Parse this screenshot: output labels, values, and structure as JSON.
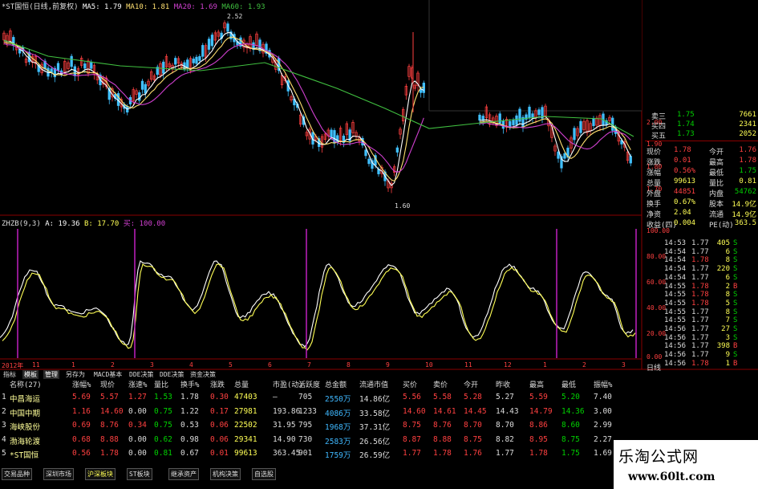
{
  "colors": {
    "up": "#ff4040",
    "down": "#00d000",
    "flat": "#e0e0e0",
    "border": "#8a0000",
    "cyan": "#3fb8ff",
    "yellow": "#ffff55",
    "ma5": "#ffffff",
    "ma10": "#ffe070",
    "ma20": "#d040d0",
    "ma60": "#40c040"
  },
  "header": {
    "title": "*ST国恒(日线,前复权)",
    "ma5": "MA5: 1.79",
    "ma10": "MA10: 1.81",
    "ma20": "MA20: 1.69",
    "ma60": "MA60: 1.93"
  },
  "price_annotations": {
    "high": "2.52",
    "low": "1.60"
  },
  "indicator": {
    "name": "ZHZB(9,3)",
    "a": "A: 19.36",
    "b": "B: 17.70",
    "buy": "买: 100.00"
  },
  "price_axis": [
    "2.00",
    "1.90",
    "1.80",
    "1.70"
  ],
  "indicator_axis": [
    "100.00",
    "80.00",
    "60.00",
    "40.00",
    "20.00",
    "0.00"
  ],
  "x_axis": {
    "year": "2012年",
    "days": [
      "11",
      "1",
      "2",
      "3",
      "4",
      "5",
      "6",
      "7",
      "8",
      "9",
      "10",
      "11",
      "12",
      "1",
      "2",
      "3"
    ]
  },
  "quote": {
    "rows": [
      {
        "label": "卖三",
        "price": "1.75",
        "vol": "7661"
      },
      {
        "label": "买四",
        "price": "1.74",
        "vol": "2341"
      },
      {
        "label": "买五",
        "price": "1.73",
        "vol": "2052"
      }
    ],
    "stats": [
      {
        "l1": "现价",
        "v1": "1.78",
        "l2": "今开",
        "v2": "1.76"
      },
      {
        "l1": "涨跌",
        "v1": "0.01",
        "l2": "最高",
        "v2": "1.78"
      },
      {
        "l1": "涨幅",
        "v1": "0.56%",
        "l2": "最低",
        "v2": "1.75"
      },
      {
        "l1": "总量",
        "v1": "99613",
        "l2": "量比",
        "v2": "0.81"
      },
      {
        "l1": "外盘",
        "v1": "44851",
        "l2": "内盘",
        "v2": "54762"
      },
      {
        "l1": "换手",
        "v1": "0.67%",
        "l2": "股本",
        "v2": "14.9亿"
      },
      {
        "l1": "净资",
        "v1": "2.04",
        "l2": "流通",
        "v2": "14.9亿"
      },
      {
        "l1": "收益(四)",
        "v1": "0.004",
        "l2": "PE(动)",
        "v2": "363.5"
      }
    ]
  },
  "ticks": [
    {
      "t": "14:53",
      "p": "1.77",
      "v": "405",
      "bs": "S",
      "c": "down"
    },
    {
      "t": "14:54",
      "p": "1.77",
      "v": "6",
      "bs": "S",
      "c": "down"
    },
    {
      "t": "14:54",
      "p": "1.78",
      "v": "8",
      "bs": "S",
      "c": "up"
    },
    {
      "t": "14:54",
      "p": "1.77",
      "v": "220",
      "bs": "S",
      "c": "down"
    },
    {
      "t": "14:54",
      "p": "1.77",
      "v": "6",
      "bs": "S",
      "c": "down"
    },
    {
      "t": "14:55",
      "p": "1.78",
      "v": "2",
      "bs": "B",
      "c": "up"
    },
    {
      "t": "14:55",
      "p": "1.78",
      "v": "8",
      "bs": "S",
      "c": "up"
    },
    {
      "t": "14:55",
      "p": "1.78",
      "v": "5",
      "bs": "S",
      "c": "up"
    },
    {
      "t": "14:55",
      "p": "1.77",
      "v": "8",
      "bs": "S",
      "c": "down"
    },
    {
      "t": "14:55",
      "p": "1.77",
      "v": "7",
      "bs": "S",
      "c": "down"
    },
    {
      "t": "14:56",
      "p": "1.77",
      "v": "27",
      "bs": "S",
      "c": "down"
    },
    {
      "t": "14:56",
      "p": "1.77",
      "v": "3",
      "bs": "S",
      "c": "down"
    },
    {
      "t": "14:56",
      "p": "1.77",
      "v": "398",
      "bs": "B",
      "c": "down"
    },
    {
      "t": "14:56",
      "p": "1.77",
      "v": "9",
      "bs": "S",
      "c": "down"
    },
    {
      "t": "14:56",
      "p": "1.78",
      "v": "1",
      "bs": "B",
      "c": "up"
    }
  ],
  "tabs": [
    "指标",
    "模板",
    "管理",
    "另存为",
    "MACD基本",
    "DDE决策",
    "DDE决策",
    "资金决策"
  ],
  "table": {
    "headers": [
      "名称(27)",
      "涨幅%",
      "现价",
      "涨速%",
      "量比",
      "换手%",
      "涨跌",
      "总量",
      "市盈(动)",
      "活跃度",
      "总金额",
      "流通市值",
      "买价",
      "卖价",
      "今开",
      "昨收",
      "最高",
      "最低",
      "振幅%"
    ],
    "rows": [
      {
        "idx": "1",
        "name": "中昌海运",
        "chg": "5.69",
        "price": "5.57",
        "spd": "1.27",
        "vr": "1.53",
        "turn": "1.78",
        "diff": "0.30",
        "vol": "47403",
        "pe": "—",
        "act": "705",
        "amt": "2550万",
        "cap": "14.86亿",
        "bid": "5.56",
        "ask": "5.58",
        "open": "5.28",
        "prev": "5.27",
        "high": "5.59",
        "low": "5.20",
        "amp": "7.40"
      },
      {
        "idx": "2",
        "name": "中国中期",
        "chg": "1.16",
        "price": "14.60",
        "spd": "0.00",
        "vr": "0.75",
        "turn": "1.22",
        "diff": "0.17",
        "vol": "27981",
        "pe": "193.86",
        "act": "1233",
        "amt": "4086万",
        "cap": "33.58亿",
        "bid": "14.60",
        "ask": "14.61",
        "open": "14.45",
        "prev": "14.43",
        "high": "14.79",
        "low": "14.36",
        "amp": "3.00"
      },
      {
        "idx": "3",
        "name": "海峡股份",
        "chg": "0.69",
        "price": "8.76",
        "spd": "0.34",
        "vr": "0.75",
        "turn": "0.53",
        "diff": "0.06",
        "vol": "22502",
        "pe": "31.95",
        "act": "795",
        "amt": "1968万",
        "cap": "37.31亿",
        "bid": "8.75",
        "ask": "8.76",
        "open": "8.70",
        "prev": "8.70",
        "high": "8.86",
        "low": "8.60",
        "amp": "2.99"
      },
      {
        "idx": "4",
        "name": "渤海轮渡",
        "chg": "0.68",
        "price": "8.88",
        "spd": "0.00",
        "vr": "0.62",
        "turn": "0.98",
        "diff": "0.06",
        "vol": "29341",
        "pe": "14.90",
        "act": "730",
        "amt": "2583万",
        "cap": "26.56亿",
        "bid": "8.87",
        "ask": "8.88",
        "open": "8.75",
        "prev": "8.82",
        "high": "8.95",
        "low": "8.75",
        "amp": "2.27"
      },
      {
        "idx": "5",
        "name": "*ST国恒",
        "chg": "0.56",
        "price": "1.78",
        "spd": "0.00",
        "vr": "0.81",
        "turn": "0.67",
        "diff": "0.01",
        "vol": "99613",
        "pe": "363.45",
        "act": "901",
        "amt": "1759万",
        "cap": "26.59亿",
        "bid": "1.77",
        "ask": "1.78",
        "open": "1.76",
        "prev": "1.77",
        "high": "1.78",
        "low": "1.75",
        "amp": "1.69"
      }
    ]
  },
  "bottom_tabs": [
    "交易品种",
    "深圳市场",
    "沪深板块",
    "ST板块",
    "继承资产",
    "机构决策",
    "自选股"
  ],
  "watermark": {
    "title": "乐淘公式网",
    "url": "www.60lt.com"
  },
  "right_label": "日线"
}
